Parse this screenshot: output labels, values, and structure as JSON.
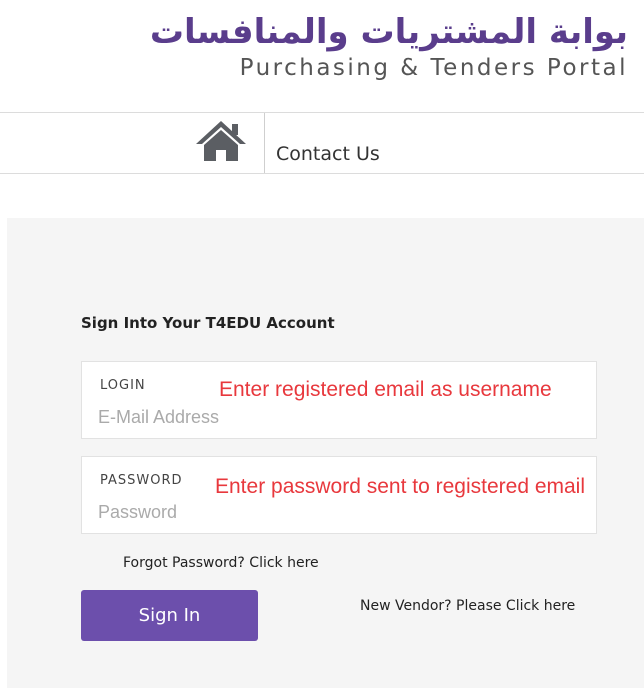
{
  "brand": {
    "arabic": "بوابة المشتريات والمنافسات",
    "english": "Purchasing & Tenders Portal"
  },
  "nav": {
    "home_icon": "home-icon",
    "contact": "Contact Us"
  },
  "login_form": {
    "title": "Sign Into Your T4EDU Account",
    "login_label": "LOGIN",
    "login_hint": "Enter registered email as username",
    "login_placeholder": "E-Mail Address",
    "password_label": "PASSWORD",
    "password_hint": "Enter password sent to registered email",
    "password_placeholder": "Password",
    "forgot": "Forgot Password? Click here",
    "sign_in": "Sign In",
    "new_vendor": "New Vendor? Please Click here"
  },
  "colors": {
    "brand_purple": "#5a3d8c",
    "button_purple": "#6c4fac",
    "hint_red": "#e8383d",
    "panel_bg": "#f5f5f5"
  }
}
